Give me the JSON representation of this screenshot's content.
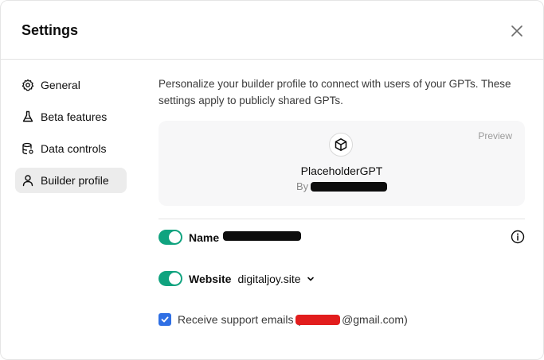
{
  "dialog": {
    "title": "Settings",
    "close_icon": "close-icon"
  },
  "sidebar": {
    "items": [
      {
        "label": "General",
        "icon": "gear-icon",
        "active": false
      },
      {
        "label": "Beta features",
        "icon": "flask-icon",
        "active": false
      },
      {
        "label": "Data controls",
        "icon": "database-icon",
        "active": false
      },
      {
        "label": "Builder profile",
        "icon": "user-icon",
        "active": true
      }
    ]
  },
  "main": {
    "intro": "Personalize your builder profile to connect with users of your GPTs. These settings apply to publicly shared GPTs.",
    "preview": {
      "label": "Preview",
      "gpt_name": "PlaceholderGPT",
      "by_label": "By"
    },
    "name_row": {
      "label": "Name",
      "toggle_on": true
    },
    "website_row": {
      "label": "Website",
      "value": "digitaljoy.site",
      "toggle_on": true
    },
    "support_emails": {
      "checked": true,
      "label": "Receive support emails (",
      "suffix": "@gmail.com)"
    }
  },
  "colors": {
    "toggle_on": "#10a37f",
    "checkbox": "#2f6fe4",
    "active_nav": "#ececec",
    "preview_bg": "#f7f7f8"
  }
}
